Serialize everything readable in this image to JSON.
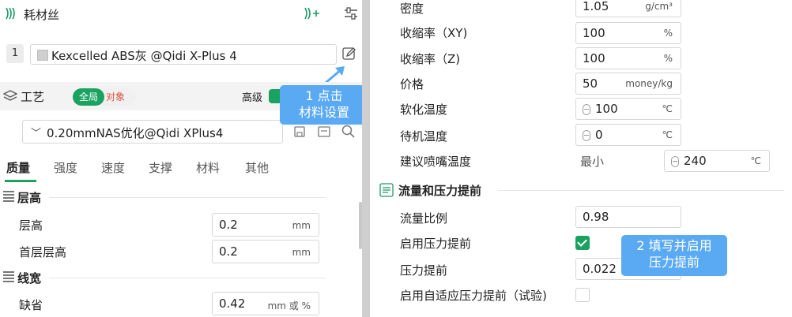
{
  "filament_header": {
    "title": "耗材丝"
  },
  "filament_item": {
    "index": "1",
    "name": "Kexcelled ABS灰 @Qidi X-Plus 4"
  },
  "process_header": {
    "title": "工艺",
    "toggle_on": "全局",
    "toggle_off": "对象",
    "advanced": "高级"
  },
  "preset": {
    "value": "0.20mmNAS优化@Qidi XPlus4"
  },
  "tabs": [
    "质量",
    "强度",
    "速度",
    "支撑",
    "材料",
    "其他"
  ],
  "sections": {
    "layer_height": {
      "title": "层高",
      "rows": [
        {
          "label": "层高",
          "value": "0.2",
          "unit": "mm"
        },
        {
          "label": "首层层高",
          "value": "0.2",
          "unit": "mm"
        }
      ]
    },
    "line_width": {
      "title": "线宽",
      "rows": [
        {
          "label": "缺省",
          "value": "0.42",
          "unit": "mm 或 %"
        }
      ]
    }
  },
  "right": {
    "rows": [
      {
        "label": "密度",
        "value": "1.05",
        "unit": "g/cm³"
      },
      {
        "label": "收缩率（XY)",
        "value": "100",
        "unit": "%"
      },
      {
        "label": "收缩率（Z)",
        "value": "100",
        "unit": "%"
      },
      {
        "label": "价格",
        "value": "50",
        "unit": "money/kg"
      },
      {
        "label": "软化温度",
        "value": "100",
        "unit": "℃"
      },
      {
        "label": "待机温度",
        "value": "0",
        "unit": "℃"
      }
    ],
    "nozzle": {
      "label": "建议喷嘴温度",
      "min_label": "最小",
      "value": "240",
      "unit": "℃"
    },
    "flow_section": {
      "title": "流量和压力提前"
    },
    "flow_ratio": {
      "label": "流量比例",
      "value": "0.98"
    },
    "pa_enable": {
      "label": "启用压力提前",
      "checked": true
    },
    "pa_value": {
      "label": "压力提前",
      "value": "0.022"
    },
    "adaptive_pa": {
      "label": "启用自适应压力提前（试验)",
      "checked": false
    }
  },
  "annotations": {
    "callout1": {
      "line1": "1 点击",
      "line2": "材料设置"
    },
    "callout2": {
      "line1": "2 填写并启用",
      "line2": "压力提前"
    }
  },
  "colors": {
    "accent": "#1aa260",
    "callout": "#5aa9f3",
    "warning": "#e0523d"
  }
}
